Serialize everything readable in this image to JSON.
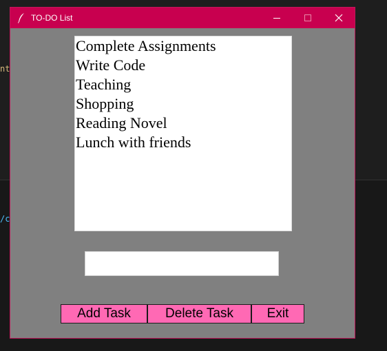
{
  "background": {
    "fragment_1": "nt",
    "fragment_2": "/c:"
  },
  "window": {
    "title": "TO-DO List",
    "title_icon": "feather-icon",
    "controls": {
      "minimize_icon": "minimize-icon",
      "maximize_icon": "maximize-icon",
      "close_icon": "close-icon"
    }
  },
  "tasks": [
    "Complete Assignments",
    "Write Code",
    "Teaching",
    "Shopping",
    "Reading Novel",
    "Lunch with friends"
  ],
  "task_entry": {
    "value": "",
    "placeholder": ""
  },
  "buttons": {
    "add_label": "Add Task",
    "delete_label": "Delete Task",
    "exit_label": "Exit"
  },
  "colors": {
    "titlebar": "#c8004f",
    "window_bg": "#808080",
    "button_bg": "#ff69b4"
  }
}
